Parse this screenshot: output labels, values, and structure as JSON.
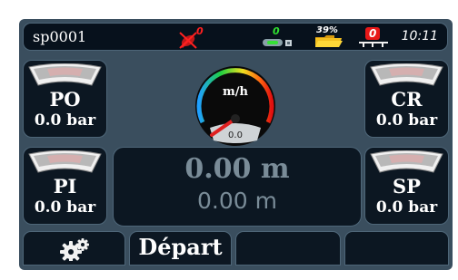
{
  "statusbar": {
    "machine_id": "sp0001",
    "gps_count": "0",
    "signal_count": "0",
    "storage_percent": "39%",
    "section_count": "0",
    "time": "10:11"
  },
  "left_tiles": [
    {
      "name": "PO",
      "value": "0.0 bar"
    },
    {
      "name": "PI",
      "value": "0.0 bar"
    }
  ],
  "right_tiles": [
    {
      "name": "CR",
      "value": "0.0 bar"
    },
    {
      "name": "SP",
      "value": "0.0 bar"
    }
  ],
  "speed": {
    "unit": "m/h",
    "value": "0.0"
  },
  "distance": {
    "primary": "0.00 m",
    "secondary": "0.00 m"
  },
  "buttons": {
    "settings_icon": "gears-icon",
    "start_label": "Départ"
  },
  "colors": {
    "background": "#3a4e5e",
    "panel": "#0c1722",
    "alert_red": "#ff2020",
    "ok_green": "#30e030",
    "text_muted": "#7a8c98"
  }
}
